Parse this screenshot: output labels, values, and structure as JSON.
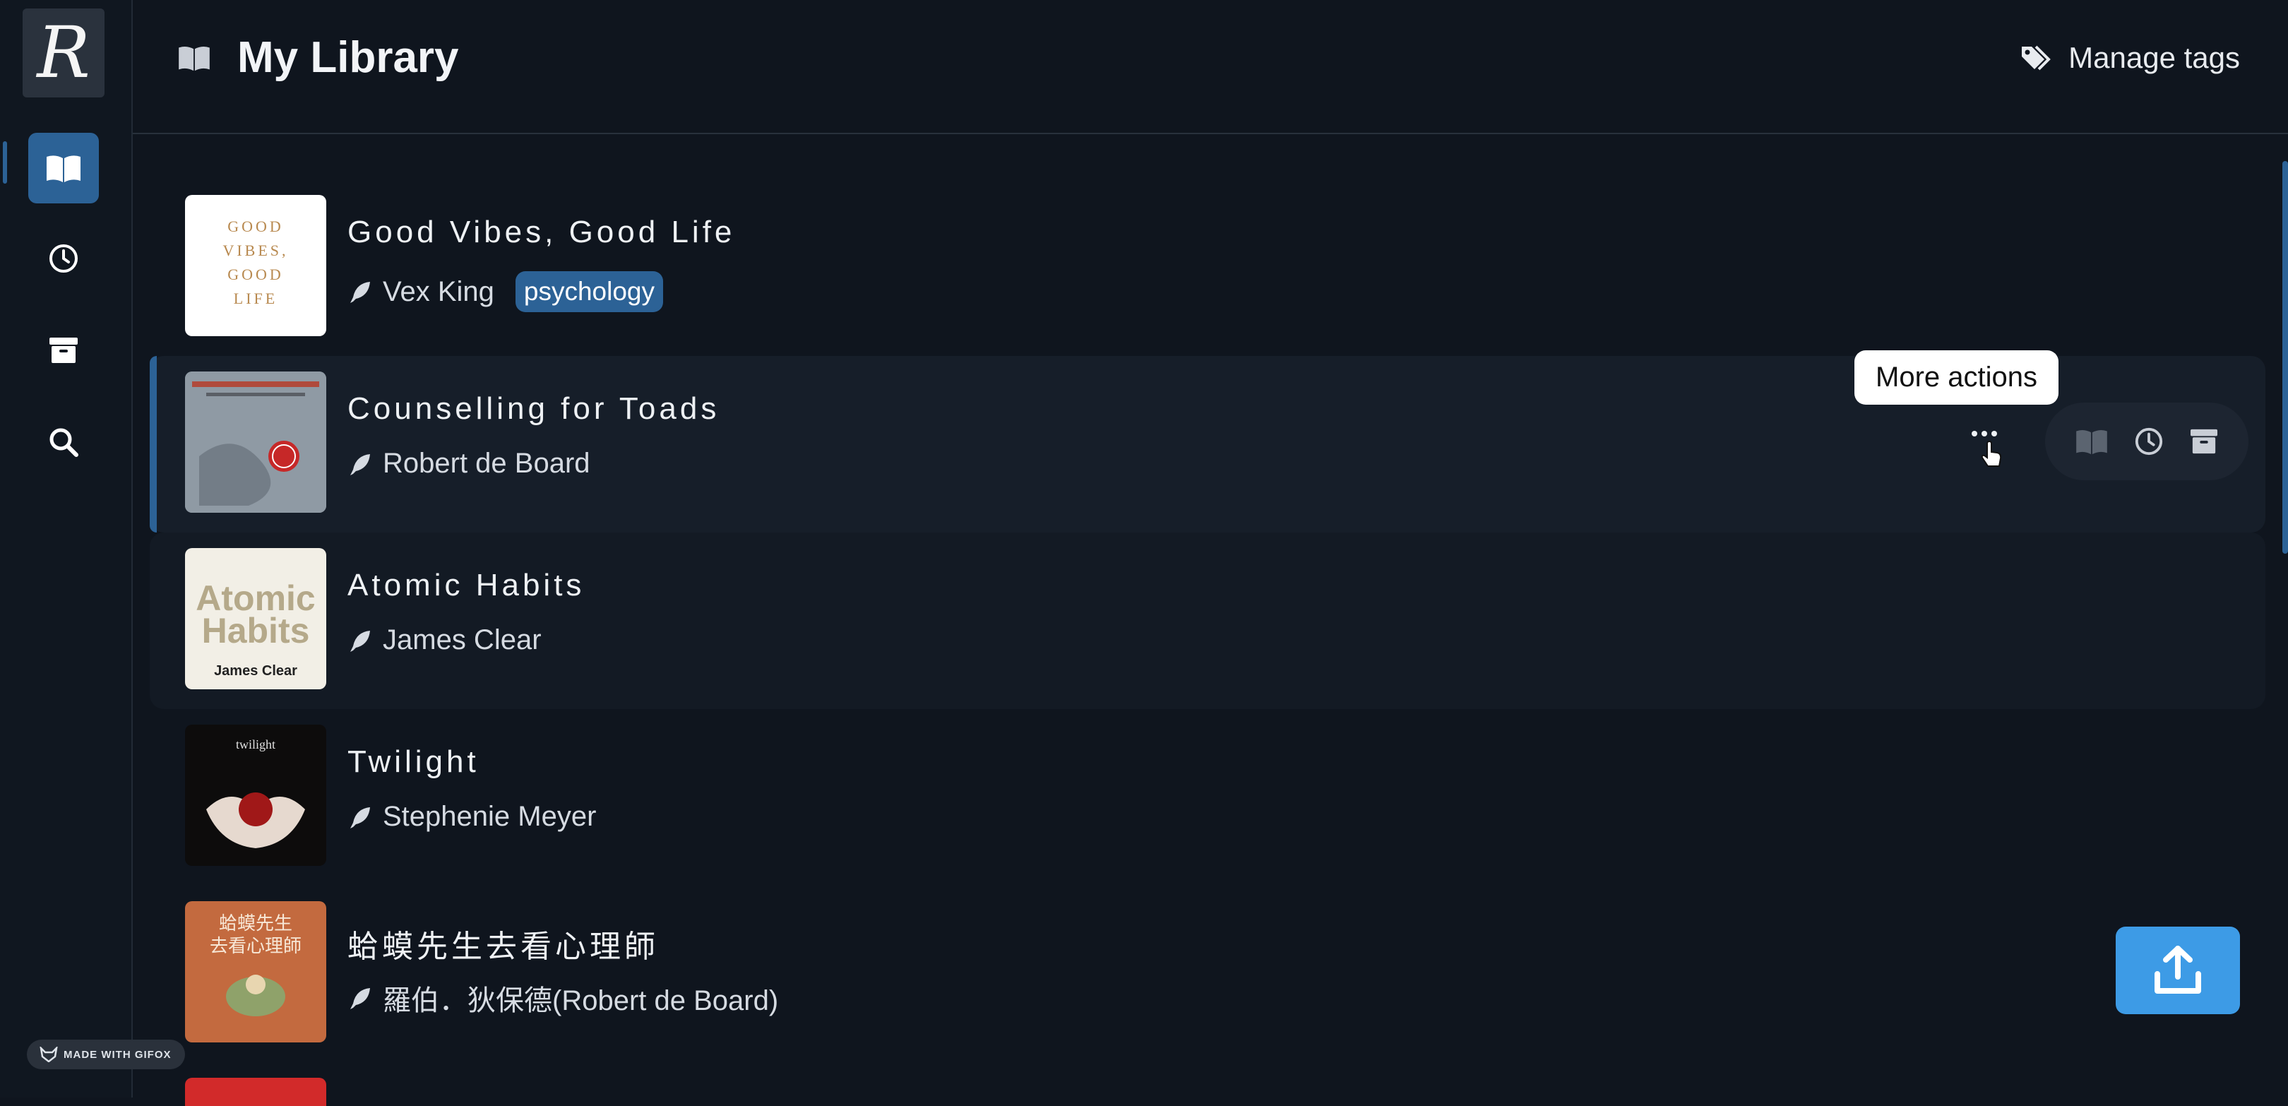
{
  "app": {
    "logo_letter": "R",
    "watermark": "MADE WITH GIFOX"
  },
  "header": {
    "title": "My Library",
    "manage_tags": "Manage tags"
  },
  "tooltip": "More actions",
  "books": [
    {
      "title": "Good Vibes, Good Life",
      "author": "Vex King",
      "tags": [
        "psychology"
      ],
      "cover_color": "#ffffff",
      "cover_text": [
        "GOOD",
        "VIBES,",
        "GOOD",
        "LIFE"
      ]
    },
    {
      "title": "Counselling for Toads",
      "author": "Robert de Board",
      "tags": [],
      "cover_color": "#8d98a3"
    },
    {
      "title": "Atomic Habits",
      "author": "James Clear",
      "tags": [],
      "cover_color": "#f2efe6",
      "cover_text": [
        "Atomic",
        "Habits",
        "James Clear"
      ]
    },
    {
      "title": "Twilight",
      "author": "Stephenie Meyer",
      "tags": [],
      "cover_color": "#0d0c0c",
      "cover_text": [
        "twilight"
      ]
    },
    {
      "title": "蛤蟆先生去看心理師",
      "author": "羅伯．狄保德(Robert de Board)",
      "tags": [],
      "cover_color": "#c36a3f",
      "cover_text": [
        "蛤蟆先生",
        "去看心理師"
      ]
    }
  ],
  "colors": {
    "accent": "#2c6296",
    "upload": "#3d9be6",
    "background": "#0f151e"
  }
}
